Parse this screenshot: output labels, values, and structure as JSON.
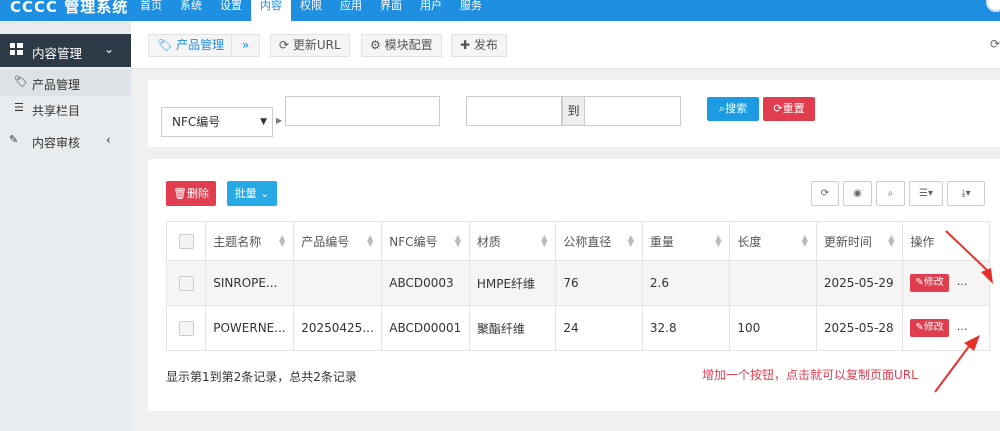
{
  "topbar": {
    "logo": "CCCC 管理系统",
    "nav": [
      "首页",
      "系统",
      "设置",
      "内容",
      "权限",
      "应用",
      "界面",
      "用户",
      "服务"
    ],
    "active_index": 3
  },
  "sidebar": {
    "group_label": "内容管理",
    "items": [
      {
        "label": "产品管理"
      },
      {
        "label": "共享栏目"
      },
      {
        "label": "内容审核"
      }
    ]
  },
  "tabs": {
    "product_tab": "产品管理",
    "dropdown": "»",
    "refresh_url": "更新URL",
    "module_config": "模块配置",
    "publish": "发布"
  },
  "search": {
    "field_select": "NFC编号",
    "range_sep": "到",
    "search_btn": "搜索",
    "reset_btn": "重置"
  },
  "toolbar": {
    "delete_btn": "删除",
    "batch_btn": "批量"
  },
  "table": {
    "headers": [
      "",
      "主题名称",
      "产品编号",
      "NFC编号",
      "材质",
      "公称直径",
      "重量",
      "长度",
      "更新时间",
      "操作"
    ],
    "rows": [
      {
        "name": "SINROPE...",
        "product_no": "",
        "nfc": "ABCD0003",
        "material": "HMPE纤维",
        "diameter": "76",
        "weight": "2.6",
        "length": "",
        "updated": "2025-05-29",
        "edit": "修改",
        "more": "..."
      },
      {
        "name": "POWERNE...",
        "product_no": "20250425...",
        "nfc": "ABCD00001",
        "material": "聚酯纤维",
        "diameter": "24",
        "weight": "32.8",
        "length": "100",
        "updated": "2025-05-28",
        "edit": "修改",
        "more": "..."
      }
    ]
  },
  "footer": {
    "summary": "显示第1到第2条记录，总共2条记录"
  },
  "annotation": {
    "text": "增加一个按钮，点击就可以复制页面URL"
  },
  "colors": {
    "primary": "#1e8fe1",
    "danger": "#e03e4f",
    "info": "#27a9e5",
    "sidebar_dark": "#2c3a47"
  }
}
